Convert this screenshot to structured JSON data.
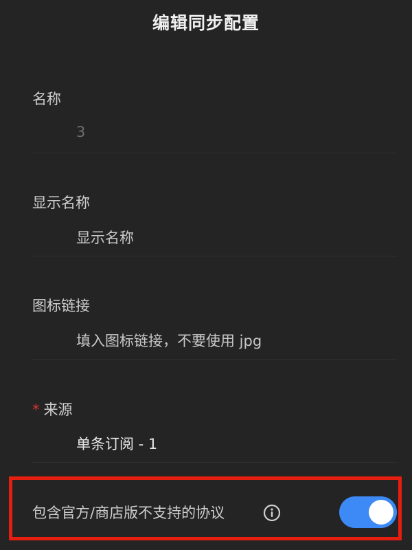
{
  "header": {
    "title": "编辑同步配置"
  },
  "form": {
    "name": {
      "label": "名称",
      "value": "3"
    },
    "display_name": {
      "label": "显示名称",
      "placeholder": "显示名称"
    },
    "icon_link": {
      "label": "图标链接",
      "placeholder": "填入图标链接，不要使用 jpg"
    },
    "source": {
      "required_mark": "*",
      "label": "来源",
      "value": "单条订阅 - 1"
    },
    "include_unsupported": {
      "label": "包含官方/商店版不支持的协议",
      "enabled": true,
      "icon": "info-circle-icon"
    }
  },
  "colors": {
    "background": "#242424",
    "accent": "#3d89f5",
    "required": "#e0342c",
    "highlight": "#e61e10"
  }
}
